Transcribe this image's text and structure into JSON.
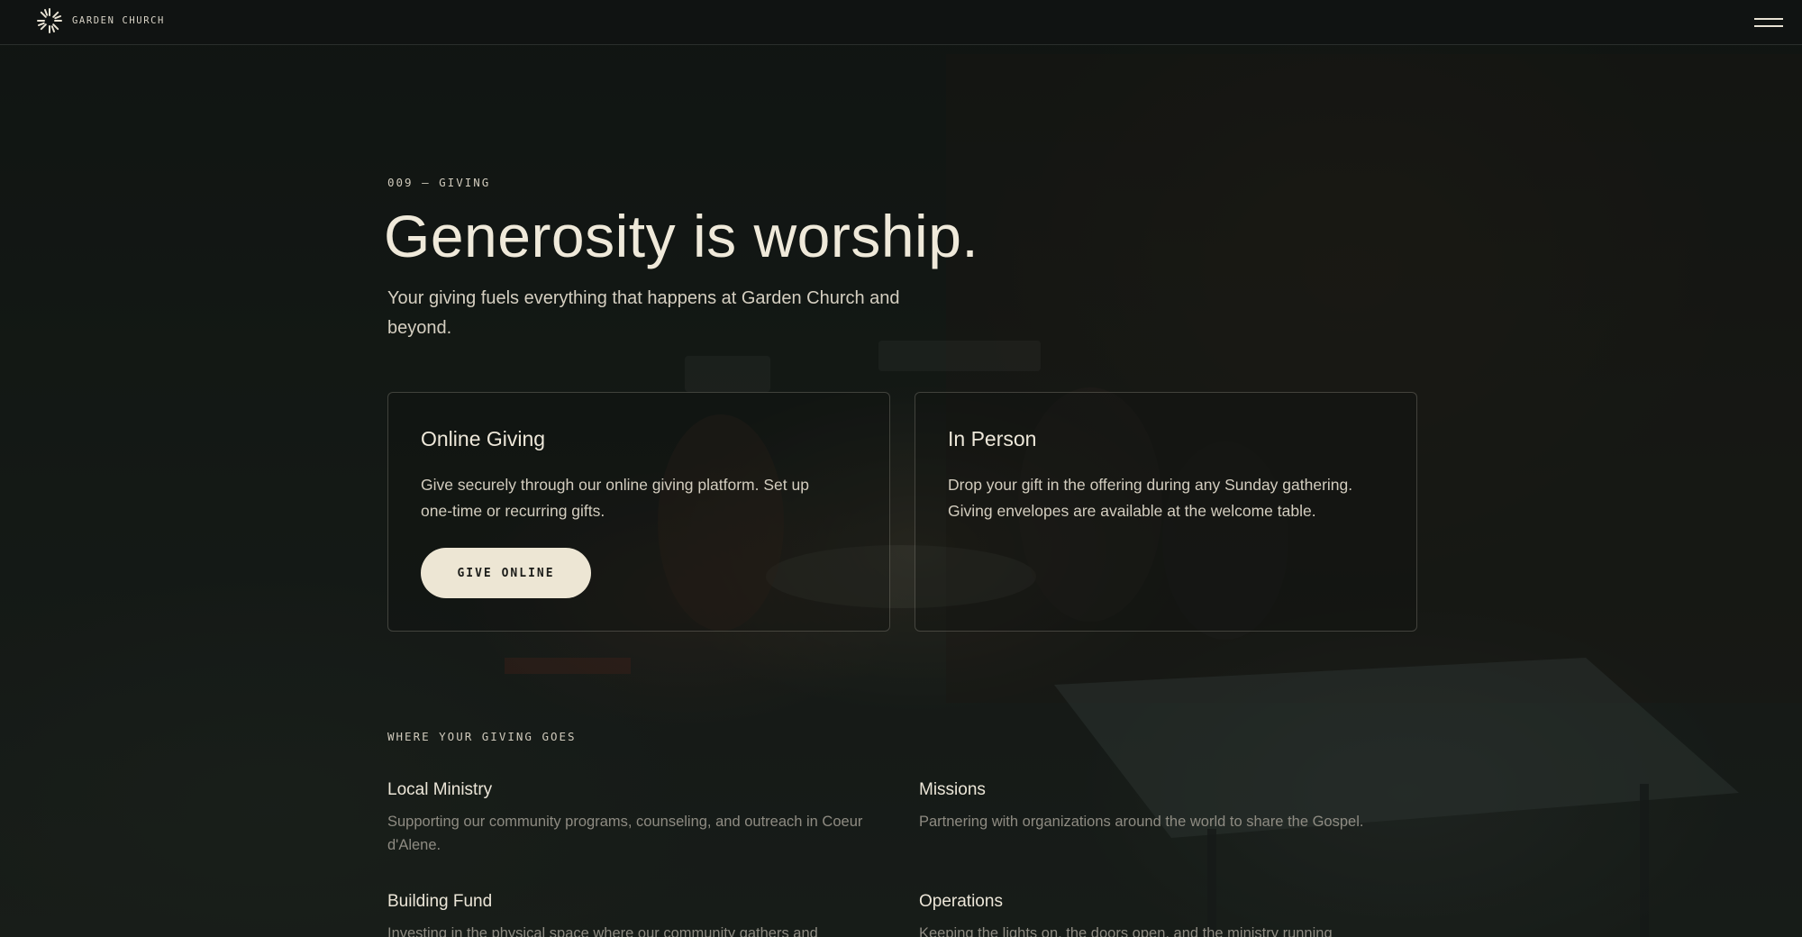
{
  "nav": {
    "brand": "GARDEN CHURCH",
    "logo_icon": "sunburst-logo-icon",
    "menu_icon": "hamburger-menu-icon"
  },
  "hero": {
    "eyebrow": "009 — GIVING",
    "title": "Generosity is worship.",
    "subtitle": "Your giving fuels everything that happens at Garden Church and beyond."
  },
  "cards": [
    {
      "title": "Online Giving",
      "body": "Give securely through our online giving platform. Set up one-time or recurring gifts.",
      "button_label": "GIVE ONLINE"
    },
    {
      "title": "In Person",
      "body": "Drop your gift in the offering during any Sunday gathering. Giving envelopes are available at the welcome table."
    }
  ],
  "funds": {
    "label": "WHERE YOUR GIVING GOES",
    "items": [
      {
        "title": "Local Ministry",
        "body": "Supporting our community programs, counseling, and outreach in Coeur d'Alene."
      },
      {
        "title": "Missions",
        "body": "Partnering with organizations around the world to share the Gospel."
      },
      {
        "title": "Building Fund",
        "body": "Investing in the physical space where our community gathers and"
      },
      {
        "title": "Operations",
        "body": "Keeping the lights on, the doors open, and the ministry running"
      }
    ]
  },
  "colors": {
    "background": "#121614",
    "text_primary": "#efe9da",
    "text_muted": "#8e8b82",
    "button_bg": "#ede6d4",
    "button_text": "#1c1d1a"
  }
}
